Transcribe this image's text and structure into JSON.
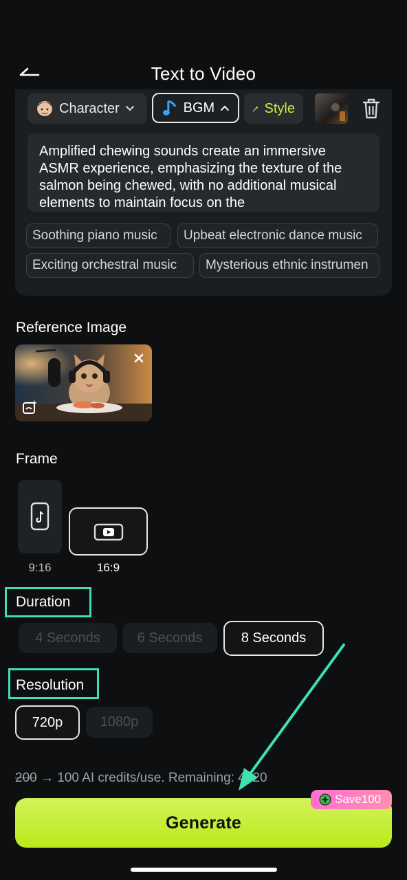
{
  "header": {
    "title": "Text to Video"
  },
  "prompt_card": {
    "chips": {
      "character": "Character",
      "bgm": "BGM",
      "style": "Style"
    },
    "prompt_text": "Amplified chewing sounds create an immersive ASMR experience, emphasizing the texture of the salmon being chewed, with no additional musical elements to maintain focus on the",
    "suggestions": [
      "Soothing piano music",
      "Upbeat electronic dance music",
      "Exciting orchestral music",
      "Mysterious ethnic instrumen"
    ]
  },
  "reference_image": {
    "title": "Reference Image"
  },
  "frame": {
    "title": "Frame",
    "options": [
      {
        "label": "9:16",
        "selected": false
      },
      {
        "label": "16:9",
        "selected": true
      }
    ]
  },
  "duration": {
    "title": "Duration",
    "options": [
      {
        "label": "4 Seconds",
        "selected": false
      },
      {
        "label": "6 Seconds",
        "selected": false
      },
      {
        "label": "8 Seconds",
        "selected": true
      }
    ]
  },
  "resolution": {
    "title": "Resolution",
    "options": [
      {
        "label": "720p",
        "selected": true
      },
      {
        "label": "1080p",
        "selected": false
      }
    ]
  },
  "credits": {
    "old_price": "200",
    "arrow": "→",
    "text": "100 AI credits/use. Remaining: 4920"
  },
  "generate": {
    "label": "Generate",
    "badge": "Save100"
  },
  "colors": {
    "background": "#0d0f10",
    "card": "#1b1e20",
    "accent_lime": "#c6ee2e",
    "highlight_teal": "#3fe0b1",
    "badge_pink": "#ff6fd0"
  }
}
